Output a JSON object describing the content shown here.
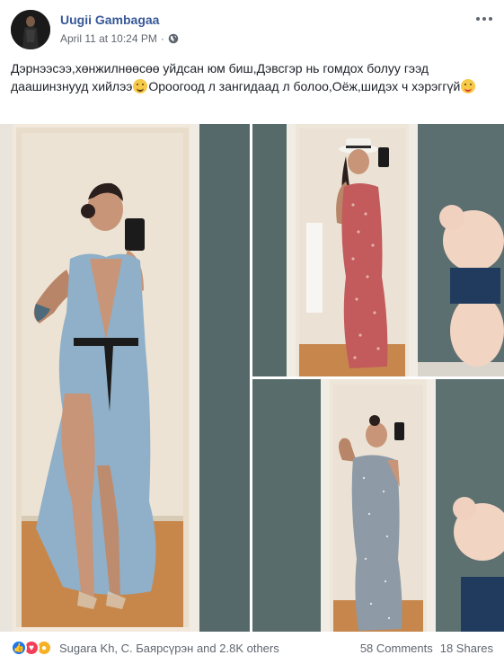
{
  "post": {
    "author": "Uugii Gambagaa",
    "timestamp": "April 11 at 10:24 PM",
    "separator": "·",
    "privacy_icon": "globe-icon",
    "text_part1": "Дэрнээсээ,хөнжилнөөсөө уйдсан юм биш,Дэвсгэр нь гомдох болуу гээд даашинзнууд хийлээ",
    "text_part2": "Ороогоод л зангидаад л болоо,Оёж,шидэх ч хэрэггүй"
  },
  "reactions": {
    "icons": [
      "like-icon",
      "love-icon",
      "wow-icon"
    ],
    "names": "Sugara Kh, С. Баярсүрэн and 2.8K others",
    "comments": "58 Comments",
    "shares": "18 Shares"
  },
  "colors": {
    "author_link": "#385898",
    "secondary_text": "#616770",
    "like_blue": "#1877f2",
    "love_red": "#f33e58",
    "wow_yellow": "#f7b125"
  }
}
